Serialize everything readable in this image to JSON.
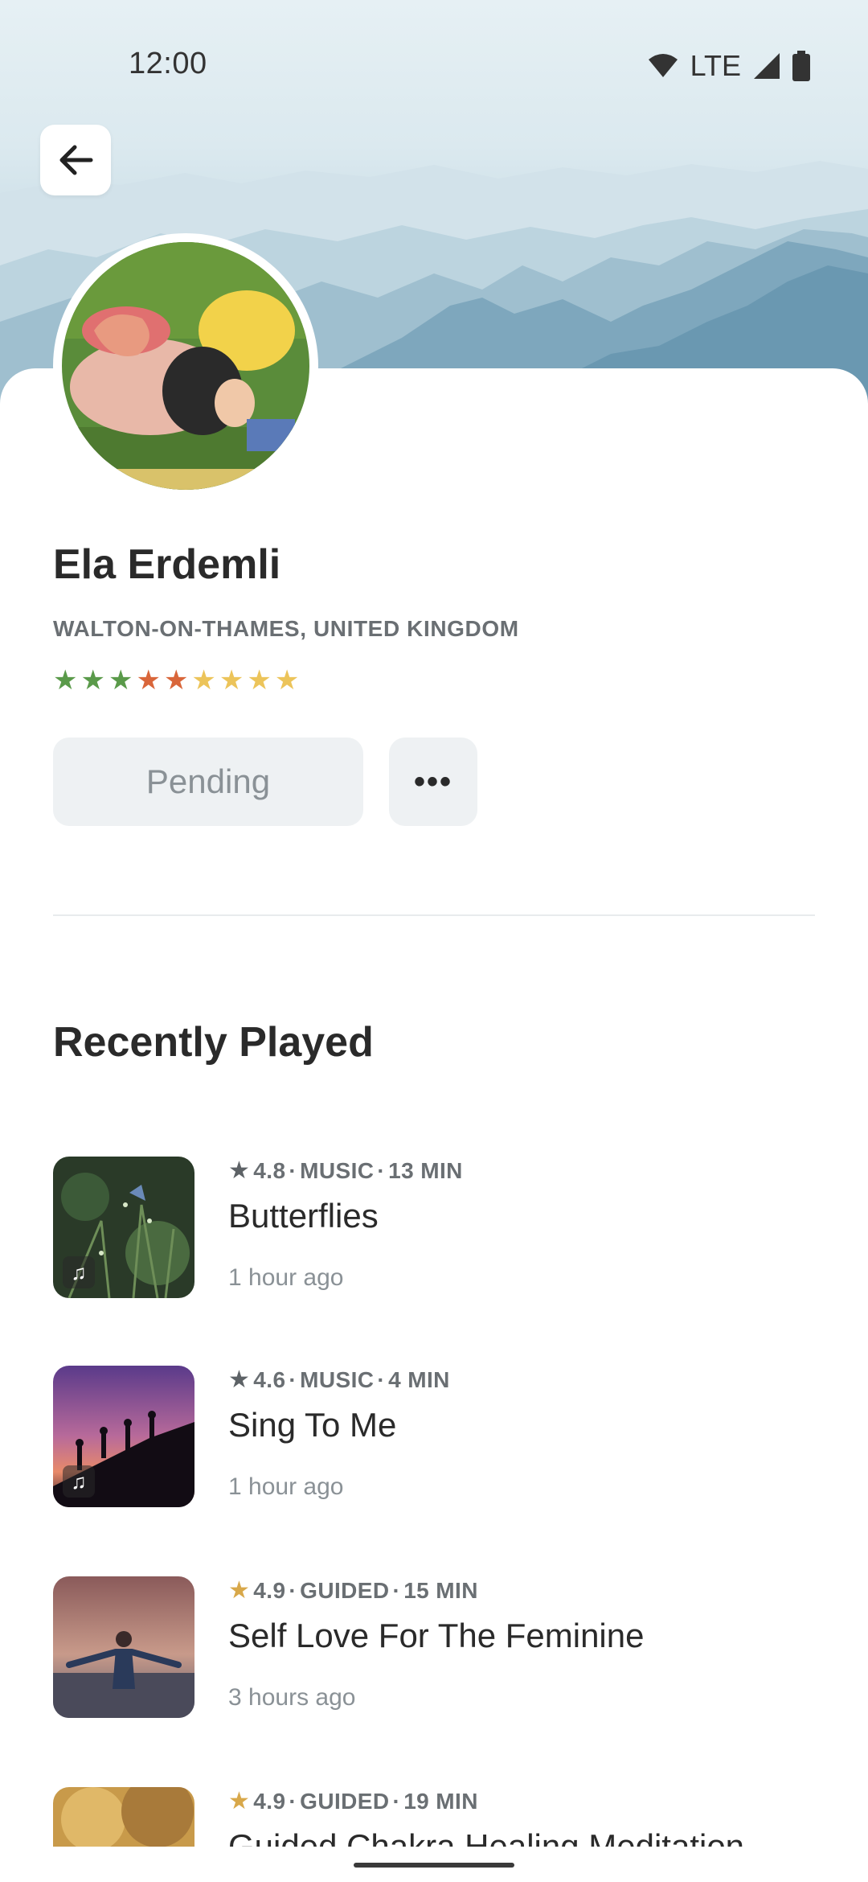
{
  "status_bar": {
    "time": "12:00",
    "network": "LTE"
  },
  "icons": {
    "back": "arrow-left-icon",
    "wifi": "wifi-icon",
    "signal": "signal-icon",
    "battery": "battery-icon",
    "music": "music-note-icon",
    "star": "star-icon"
  },
  "profile": {
    "name": "Ela Erdemli",
    "location": "WALTON-ON-THAMES, UNITED KINGDOM",
    "stars": [
      "#5a9a4a",
      "#5a9a4a",
      "#5a9a4a",
      "#d9663a",
      "#d9663a",
      "#ecc45a",
      "#ecc45a",
      "#ecc45a",
      "#ecc45a"
    ],
    "pending_label": "Pending",
    "more_label": "•••"
  },
  "recently_played": {
    "title": "Recently Played",
    "items": [
      {
        "rating": "4.8",
        "category": "MUSIC",
        "duration": "13 MIN",
        "title": "Butterflies",
        "time": "1 hour ago",
        "star_color": "#5d6266",
        "type": "music"
      },
      {
        "rating": "4.6",
        "category": "MUSIC",
        "duration": "4 MIN",
        "title": "Sing To Me",
        "time": "1 hour ago",
        "star_color": "#5d6266",
        "type": "music"
      },
      {
        "rating": "4.9",
        "category": "GUIDED",
        "duration": "15 MIN",
        "title": "Self Love For The Feminine",
        "time": "3 hours ago",
        "star_color": "#d8a84a",
        "type": "guided"
      },
      {
        "rating": "4.9",
        "category": "GUIDED",
        "duration": "19 MIN",
        "title": "Guided Chakra Healing Meditation",
        "time": "",
        "star_color": "#d8a84a",
        "type": "guided"
      }
    ]
  },
  "colors": {
    "accent_gray": "#6a6f73",
    "button_bg": "#eef1f3",
    "rating_gold": "#d8a84a"
  }
}
